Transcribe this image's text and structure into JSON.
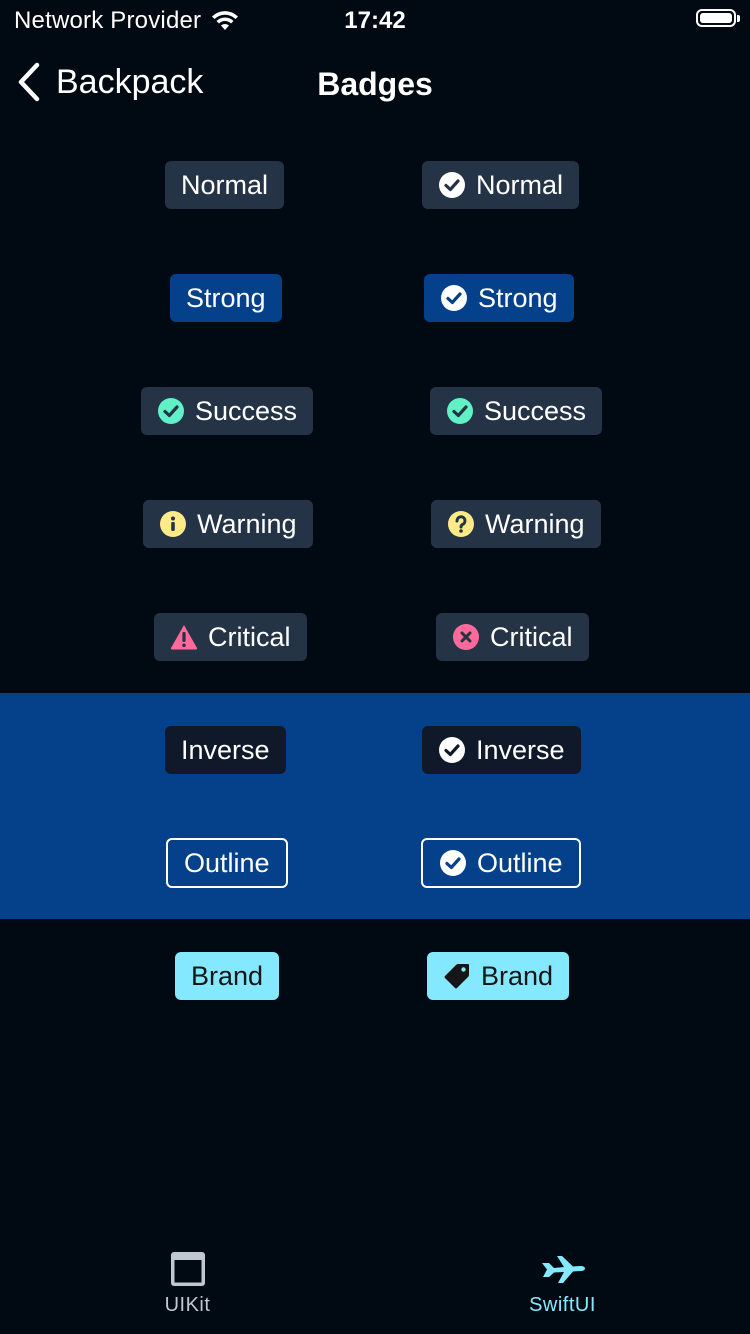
{
  "status_bar": {
    "carrier": "Network Provider",
    "time": "17:42"
  },
  "nav": {
    "back_label": "Backpack",
    "title": "Badges"
  },
  "badges": {
    "normal": "Normal",
    "strong": "Strong",
    "success": "Success",
    "warning": "Warning",
    "critical": "Critical",
    "inverse": "Inverse",
    "outline": "Outline",
    "brand": "Brand"
  },
  "icons": {
    "check": "check-circle-icon",
    "success": "check-circle-icon",
    "info": "info-circle-icon",
    "help": "help-circle-icon",
    "critical_left": "warning-triangle-icon",
    "critical_right": "close-circle-icon",
    "brand": "tag-icon"
  },
  "colors": {
    "background": "#010913",
    "badge_normal": "#243346",
    "badge_strong": "#05408a",
    "success": "#62f1c6",
    "warning": "#feeb87",
    "critical": "#ff6a9a",
    "brand": "#84e9ff",
    "inverse_band": "#05408a"
  },
  "tabs": [
    {
      "label": "UIKit"
    },
    {
      "label": "SwiftUI"
    }
  ]
}
